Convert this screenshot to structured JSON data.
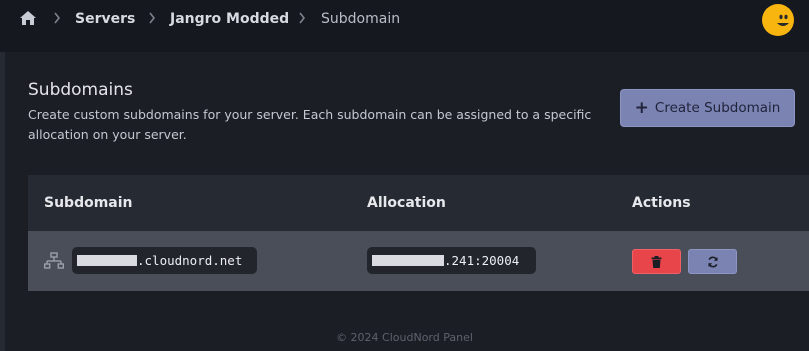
{
  "breadcrumb": {
    "home_icon": "home-icon",
    "items": [
      {
        "label": "Servers"
      },
      {
        "label": "Jangro Modded"
      },
      {
        "label": "Subdomain"
      }
    ]
  },
  "user": {
    "avatar_icon": "smiley-avatar-icon",
    "avatar_color": "#f8b50f"
  },
  "section": {
    "title": "Subdomains",
    "description": "Create custom subdomains for your server. Each subdomain can be assigned to a specific allocation on your server.",
    "create_button": {
      "icon": "plus-icon",
      "label": "Create Subdomain"
    }
  },
  "table": {
    "columns": [
      "Subdomain",
      "Allocation",
      "Actions"
    ],
    "rows": [
      {
        "icon": "network-icon",
        "subdomain_suffix": ".cloudnord.net",
        "allocation_suffix": ".241:20004",
        "actions": [
          {
            "icon": "trash-icon",
            "color": "#e8454a"
          },
          {
            "icon": "sync-icon",
            "color": "#7b83b3"
          }
        ]
      }
    ]
  },
  "footer": {
    "text": "© 2024 CloudNord Panel"
  },
  "colors": {
    "accent": "#7b83b3",
    "danger": "#e8454a",
    "background": "#15181f"
  }
}
